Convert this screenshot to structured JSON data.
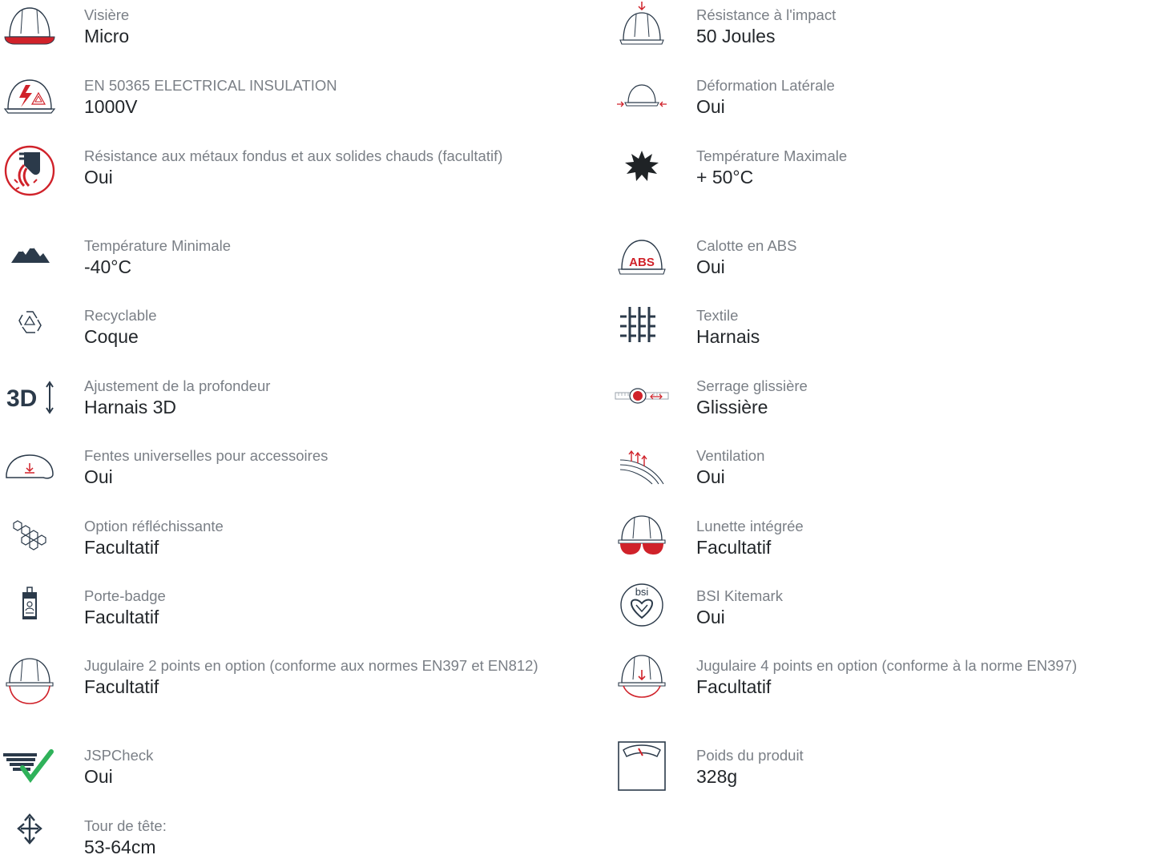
{
  "left": [
    {
      "icon": "helmet-visor-icon",
      "label": "Visière",
      "value": "Micro"
    },
    {
      "icon": "electrical-insulation-icon",
      "label": "EN 50365 ELECTRICAL INSULATION",
      "value": "1000V"
    },
    {
      "icon": "molten-metal-icon",
      "label": "Résistance aux métaux fondus et aux solides chauds (facultatif)",
      "value": "Oui"
    },
    {
      "icon": "mountains-cold-icon",
      "label": "Température Minimale",
      "value": "-40°C"
    },
    {
      "icon": "recycle-icon",
      "label": "Recyclable",
      "value": "Coque"
    },
    {
      "icon": "3d-adjust-icon",
      "label": "Ajustement de la profondeur",
      "value": "Harnais 3D"
    },
    {
      "icon": "accessory-slot-icon",
      "label": "Fentes universelles pour accessoires",
      "value": "Oui"
    },
    {
      "icon": "reflective-honeycomb-icon",
      "label": "Option réfléchissante",
      "value": "Facultatif"
    },
    {
      "icon": "badge-holder-icon",
      "label": "Porte-badge",
      "value": "Facultatif"
    },
    {
      "icon": "chinstrap-2pt-icon",
      "label": "Jugulaire 2 points en option (conforme aux normes EN397 et EN812)",
      "value": "Facultatif"
    },
    {
      "icon": "jspcheck-icon",
      "label": "JSPCheck",
      "value": "Oui"
    },
    {
      "icon": "head-size-arrows-icon",
      "label": "Tour de tête:",
      "value": "53-64cm"
    }
  ],
  "right": [
    {
      "icon": "impact-helmet-icon",
      "label": "Résistance à l'impact",
      "value": "50 Joules"
    },
    {
      "icon": "lateral-deformation-icon",
      "label": "Déformation Latérale",
      "value": "Oui"
    },
    {
      "icon": "sun-max-temp-icon",
      "label": "Température Maximale",
      "value": "+ 50°C"
    },
    {
      "icon": "abs-shell-icon",
      "label": "Calotte en ABS",
      "value": "Oui"
    },
    {
      "icon": "textile-icon",
      "label": "Textile",
      "value": "Harnais"
    },
    {
      "icon": "slide-fit-icon",
      "label": "Serrage glissière",
      "value": "Glissière"
    },
    {
      "icon": "ventilation-icon",
      "label": "Ventilation",
      "value": "Oui"
    },
    {
      "icon": "integrated-goggles-icon",
      "label": "Lunette intégrée",
      "value": "Facultatif"
    },
    {
      "icon": "bsi-kitemark-icon",
      "label": "BSI Kitemark",
      "value": "Oui",
      "icon_text": "bsi"
    },
    {
      "icon": "chinstrap-4pt-icon",
      "label": "Jugulaire 4 points en option (conforme à la norme EN397)",
      "value": "Facultatif"
    },
    {
      "icon": "weight-scale-icon",
      "label": "Poids du produit",
      "value": "328g"
    }
  ],
  "colors": {
    "accent": "#d0222a",
    "icon": "#2b3a4a",
    "label": "#7a7f86",
    "value": "#23272b"
  }
}
